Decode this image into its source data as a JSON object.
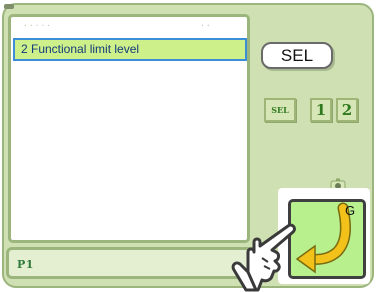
{
  "list": {
    "items": [
      {
        "label": "2 Functional limit level",
        "selected": true
      }
    ]
  },
  "page_tab": {
    "label": "P1"
  },
  "buttons": {
    "sel_large": "SEL",
    "sel_small": "SEL",
    "num1": "1",
    "num2": "2"
  },
  "go_button": {
    "label": "G",
    "icon": "return-arrow-icon"
  },
  "pointer": {
    "icon": "hand-pointer-icon"
  },
  "colors": {
    "frame_bg": "#cfe0b2",
    "frame_border": "#9bb57d",
    "selected_item_bg": "#cdf08a",
    "selected_item_border": "#3c8fd6",
    "go_button_bg": "#b7f08d",
    "go_arrow": "#f2c21b"
  }
}
